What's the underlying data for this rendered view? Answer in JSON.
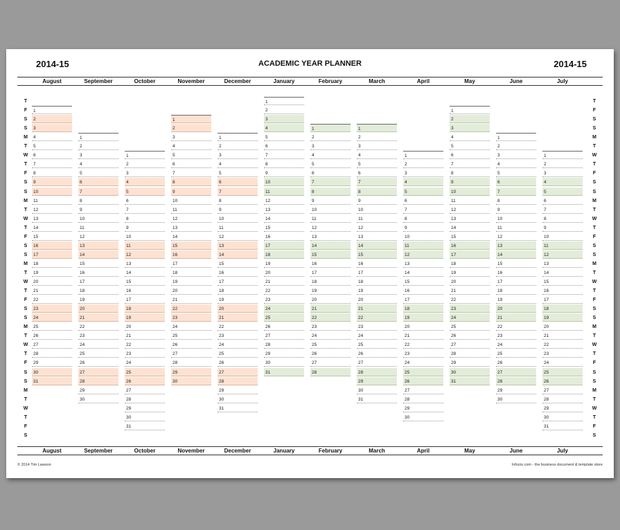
{
  "header": {
    "year_left": "2014-15",
    "title": "ACADEMIC YEAR PLANNER",
    "year_right": "2014-15"
  },
  "months": [
    {
      "name": "August",
      "days": 31,
      "start": 1,
      "shade": "a"
    },
    {
      "name": "September",
      "days": 30,
      "start": 4,
      "shade": "a"
    },
    {
      "name": "October",
      "days": 31,
      "start": 6,
      "shade": "a"
    },
    {
      "name": "November",
      "days": 30,
      "start": 2,
      "shade": "a"
    },
    {
      "name": "December",
      "days": 31,
      "start": 4,
      "shade": "a"
    },
    {
      "name": "January",
      "days": 31,
      "start": 0,
      "shade": "b"
    },
    {
      "name": "February",
      "days": 28,
      "start": 3,
      "shade": "b"
    },
    {
      "name": "March",
      "days": 31,
      "start": 3,
      "shade": "b"
    },
    {
      "name": "April",
      "days": 30,
      "start": 6,
      "shade": "b"
    },
    {
      "name": "May",
      "days": 31,
      "start": 1,
      "shade": "b"
    },
    {
      "name": "June",
      "days": 30,
      "start": 4,
      "shade": "b"
    },
    {
      "name": "July",
      "days": 31,
      "start": 6,
      "shade": "b"
    }
  ],
  "weekdays": [
    "T",
    "F",
    "S",
    "S",
    "M",
    "T",
    "W",
    "T",
    "F",
    "S",
    "S",
    "M",
    "T",
    "W",
    "T",
    "F",
    "S",
    "S",
    "M",
    "T",
    "W",
    "T",
    "F",
    "S",
    "S",
    "M",
    "T",
    "W",
    "T",
    "F",
    "S",
    "S",
    "M",
    "T",
    "W",
    "T",
    "F",
    "S"
  ],
  "footer": {
    "left": "© 2014 Tim Lawson",
    "right": "Infozio.com - the business document & template store"
  }
}
